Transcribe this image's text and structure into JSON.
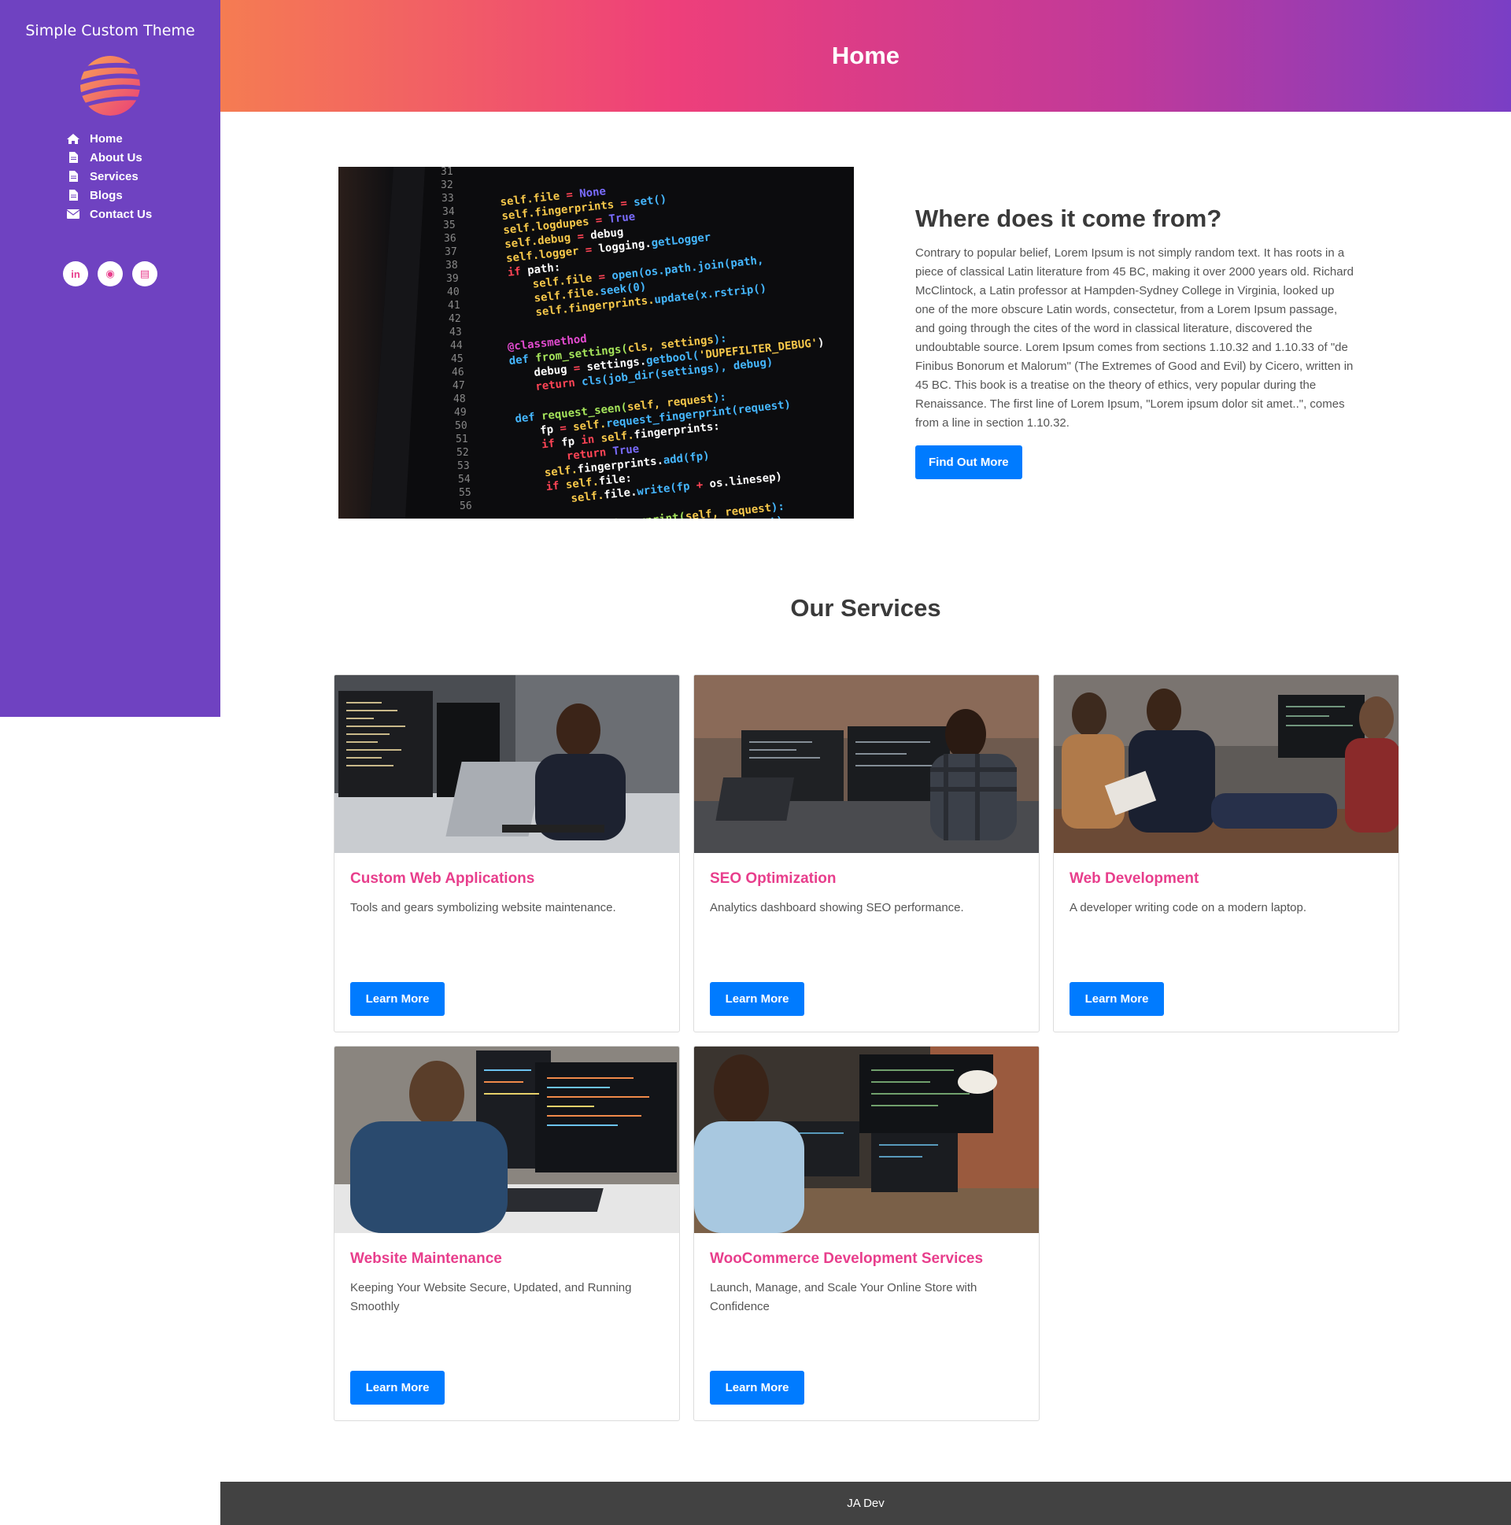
{
  "sidebar": {
    "site_title": "Simple Custom Theme",
    "logo_icon": "striped-globe-logo",
    "nav": [
      {
        "label": "Home",
        "icon": "home-icon"
      },
      {
        "label": "About Us",
        "icon": "file-icon"
      },
      {
        "label": "Services",
        "icon": "file-icon"
      },
      {
        "label": "Blogs",
        "icon": "file-icon"
      },
      {
        "label": "Contact Us",
        "icon": "envelope-icon"
      }
    ],
    "social": [
      {
        "icon": "linkedin-icon",
        "glyph": "in"
      },
      {
        "icon": "github-icon",
        "glyph": "◉"
      },
      {
        "icon": "resume-icon",
        "glyph": "▤"
      }
    ]
  },
  "header": {
    "title": "Home"
  },
  "about": {
    "heading": "Where does it come from?",
    "body": "Contrary to popular belief, Lorem Ipsum is not simply random text. It has roots in a piece of classical Latin literature from 45 BC, making it over 2000 years old. Richard McClintock, a Latin professor at Hampden-Sydney College in Virginia, looked up one of the more obscure Latin words, consectetur, from a Lorem Ipsum passage, and going through the cites of the word in classical literature, discovered the undoubtable source. Lorem Ipsum comes from sections 1.10.32 and 1.10.33 of \"de Finibus Bonorum et Malorum\" (The Extremes of Good and Evil) by Cicero, written in 45 BC. This book is a treatise on the theory of ethics, very popular during the Renaissance. The first line of Lorem Ipsum, \"Lorem ipsum dolor sit amet..\", comes from a line in section 1.10.32.",
    "button": "Find Out More"
  },
  "services": {
    "title": "Our Services",
    "cards": [
      {
        "title": "Custom Web Applications",
        "desc": "Tools and gears symbolizing website maintenance.",
        "button": "Learn More"
      },
      {
        "title": "SEO Optimization",
        "desc": "Analytics dashboard showing SEO performance.",
        "button": "Learn More"
      },
      {
        "title": "Web Development",
        "desc": "A developer writing code on a modern laptop.",
        "button": "Learn More"
      },
      {
        "title": "Website Maintenance",
        "desc": "Keeping Your Website Secure, Updated, and Running Smoothly",
        "button": "Learn More"
      },
      {
        "title": "WooCommerce Development Services",
        "desc": "Launch, Manage, and Scale Your Online Store with Confidence",
        "button": "Learn More"
      }
    ]
  },
  "footer": {
    "text": "JA Dev"
  },
  "colors": {
    "sidebar": "#6f42c1",
    "accent": "#e83e8c",
    "button": "#007bff",
    "footer": "#424242"
  }
}
